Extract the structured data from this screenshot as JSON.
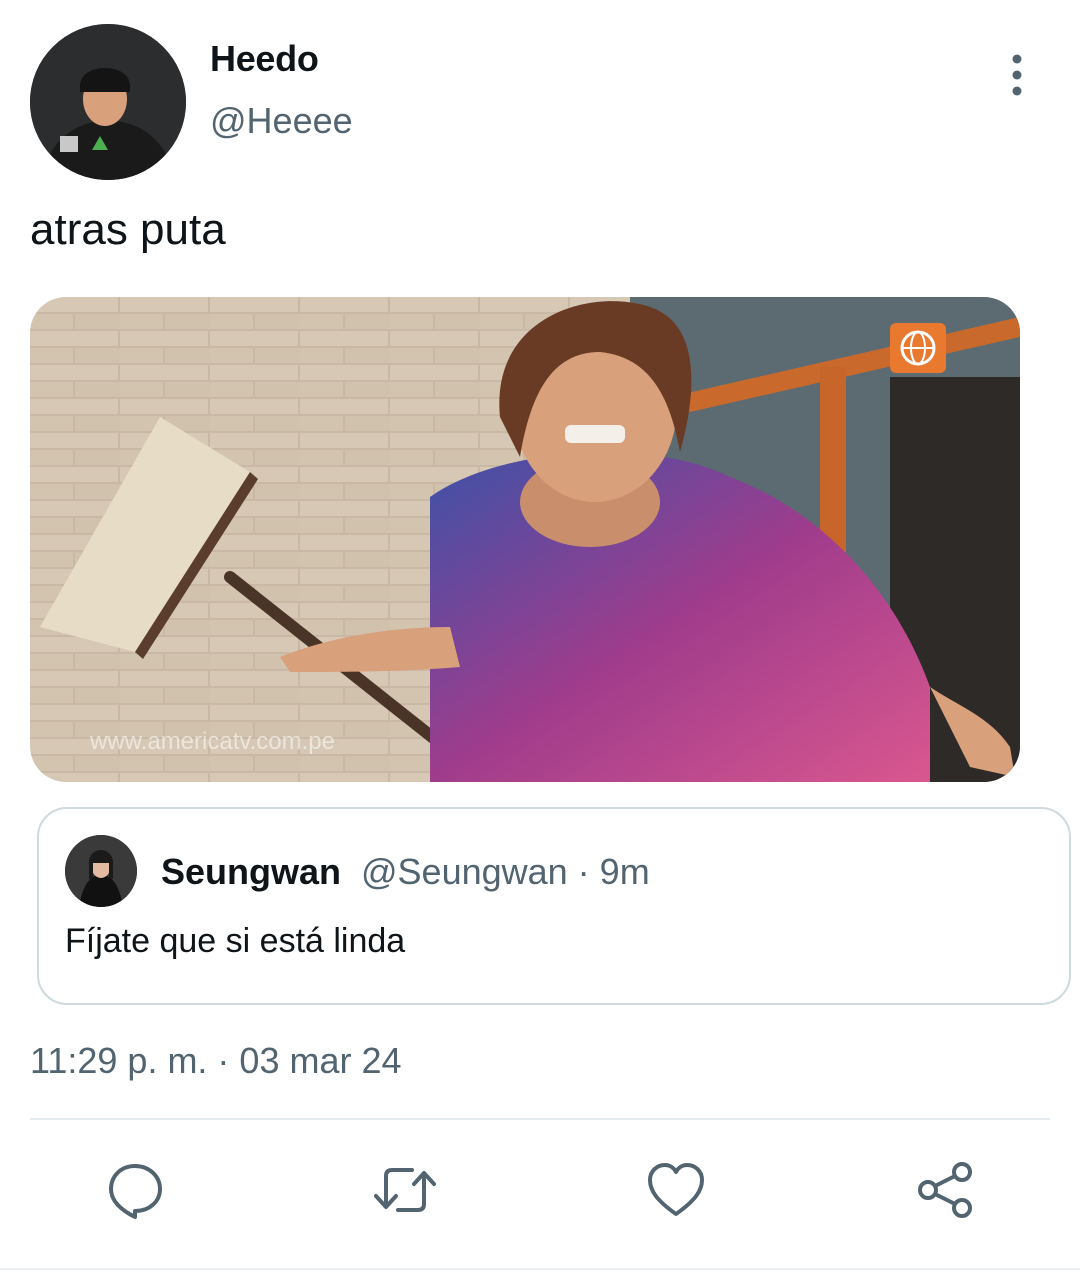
{
  "author": {
    "display_name": "Heedo",
    "handle": "@Heeee"
  },
  "tweet": {
    "text": "atras puta",
    "timestamp": "11:29 p. m. · 03 mar 24"
  },
  "media": {
    "watermark_text": "www.americatv.com.pe"
  },
  "quoted_tweet": {
    "display_name": "Seungwan",
    "meta": "@Seungwan · 9m",
    "text": "Fíjate que si está linda"
  },
  "icons": {
    "more": "more-vertical-icon",
    "reply": "reply-icon",
    "retweet": "retweet-icon",
    "like": "heart-icon",
    "share": "share-icon"
  },
  "colors": {
    "text_primary": "#0f1419",
    "text_secondary": "#536471",
    "border": "#cfd9de",
    "icon": "#536471"
  }
}
